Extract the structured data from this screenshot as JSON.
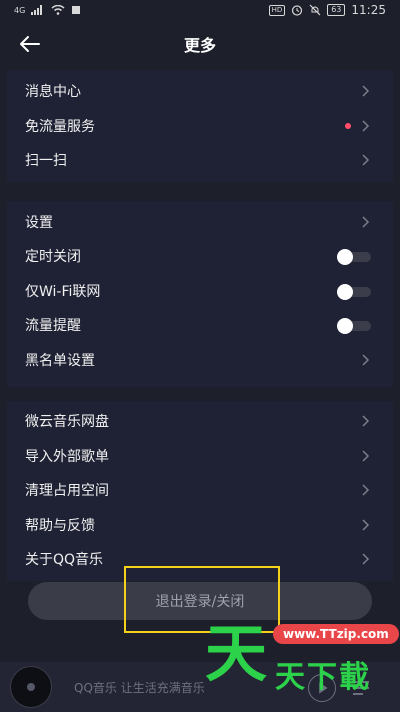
{
  "status_bar": {
    "network": "4G",
    "hd": "HD",
    "battery": "63",
    "time": "11:25"
  },
  "header": {
    "title": "更多"
  },
  "groups": [
    {
      "items": [
        {
          "label": "消息中心",
          "control": "chevron"
        },
        {
          "label": "免流量服务",
          "control": "chevron",
          "badge": "red-dot"
        },
        {
          "label": "扫一扫",
          "control": "chevron"
        }
      ]
    },
    {
      "items": [
        {
          "label": "设置",
          "control": "chevron"
        },
        {
          "label": "定时关闭",
          "control": "toggle",
          "on": false
        },
        {
          "label": "仅Wi-Fi联网",
          "control": "toggle",
          "on": false
        },
        {
          "label": "流量提醒",
          "control": "toggle",
          "on": false
        },
        {
          "label": "黑名单设置",
          "control": "chevron"
        }
      ]
    },
    {
      "items": [
        {
          "label": "微云音乐网盘",
          "control": "chevron"
        },
        {
          "label": "导入外部歌单",
          "control": "chevron"
        },
        {
          "label": "清理占用空间",
          "control": "chevron"
        },
        {
          "label": "帮助与反馈",
          "control": "chevron"
        },
        {
          "label": "关于QQ音乐",
          "control": "chevron"
        }
      ]
    }
  ],
  "logout_button": "退出登录/关闭",
  "player": {
    "text": "QQ音乐  让生活充满音乐"
  },
  "watermark": {
    "logo_char": "天",
    "url": "www.TTzip.com",
    "text": "天下載"
  },
  "colors": {
    "background": "#1d1f2b",
    "group_background": "#1f2234",
    "badge": "#ff4d6a",
    "highlight": "#f5d21a",
    "watermark_green": "#2bd24a"
  }
}
